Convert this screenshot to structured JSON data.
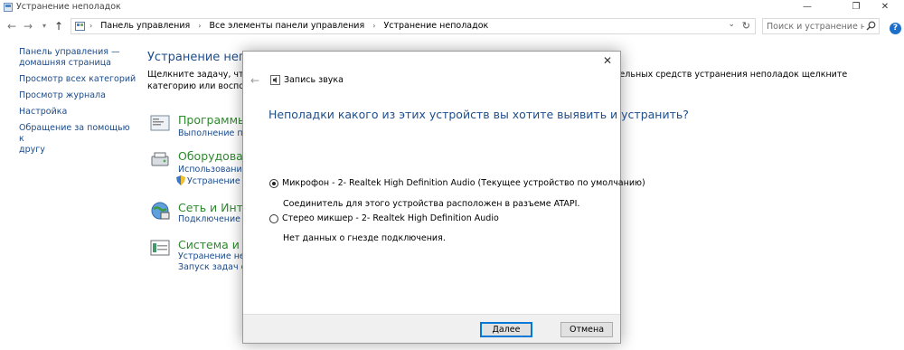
{
  "window": {
    "title": "Устранение неполадок",
    "minimize": "—",
    "maximize": "❐",
    "close": "✕"
  },
  "address": {
    "crumbs": [
      "Панель управления",
      "Все элементы панели управления",
      "Устранение неполадок"
    ],
    "search_placeholder": "Поиск и устранение неполад...",
    "help": "?"
  },
  "leftnav": {
    "home_line1": "Панель управления —",
    "home_line2": "домашняя страница",
    "items": [
      "Просмотр всех категорий",
      "Просмотр журнала",
      "Настройка"
    ],
    "help_line1": "Обращение за помощью к",
    "help_line2": "другу"
  },
  "main": {
    "heading": "Устранение неполад",
    "desc_line1_left": "Щелкните задачу, чтобы а",
    "desc_line1_right": "загрузки дополнительных средств устранения неполадок щелкните",
    "desc_line2": "категорию или воспользу"
  },
  "categories": [
    {
      "title": "Программы",
      "links": [
        "Выполнение про"
      ]
    },
    {
      "title": "Оборудование",
      "links": [
        "Использование пр",
        "Устранение нен"
      ]
    },
    {
      "title": "Сеть и Интерн",
      "links": [
        "Подключение к И"
      ]
    },
    {
      "title": "Система и без",
      "links": [
        "Устранение непол",
        "Запуск задач обсл"
      ]
    }
  ],
  "dialog": {
    "title": "Запись звука",
    "question": "Неполадки какого из этих устройств вы хотите выявить и устранить?",
    "options": [
      {
        "label": "Микрофон - 2- Realtek High Definition Audio (Текущее устройство по умолчанию)",
        "note": "Соединитель для этого устройства расположен в разъеме ATAPI.",
        "selected": true
      },
      {
        "label": "Стерео микшер - 2- Realtek High Definition Audio",
        "note": "Нет данных о гнезде подключения.",
        "selected": false
      }
    ],
    "next_label": "Далее",
    "cancel_label": "Отмена"
  }
}
